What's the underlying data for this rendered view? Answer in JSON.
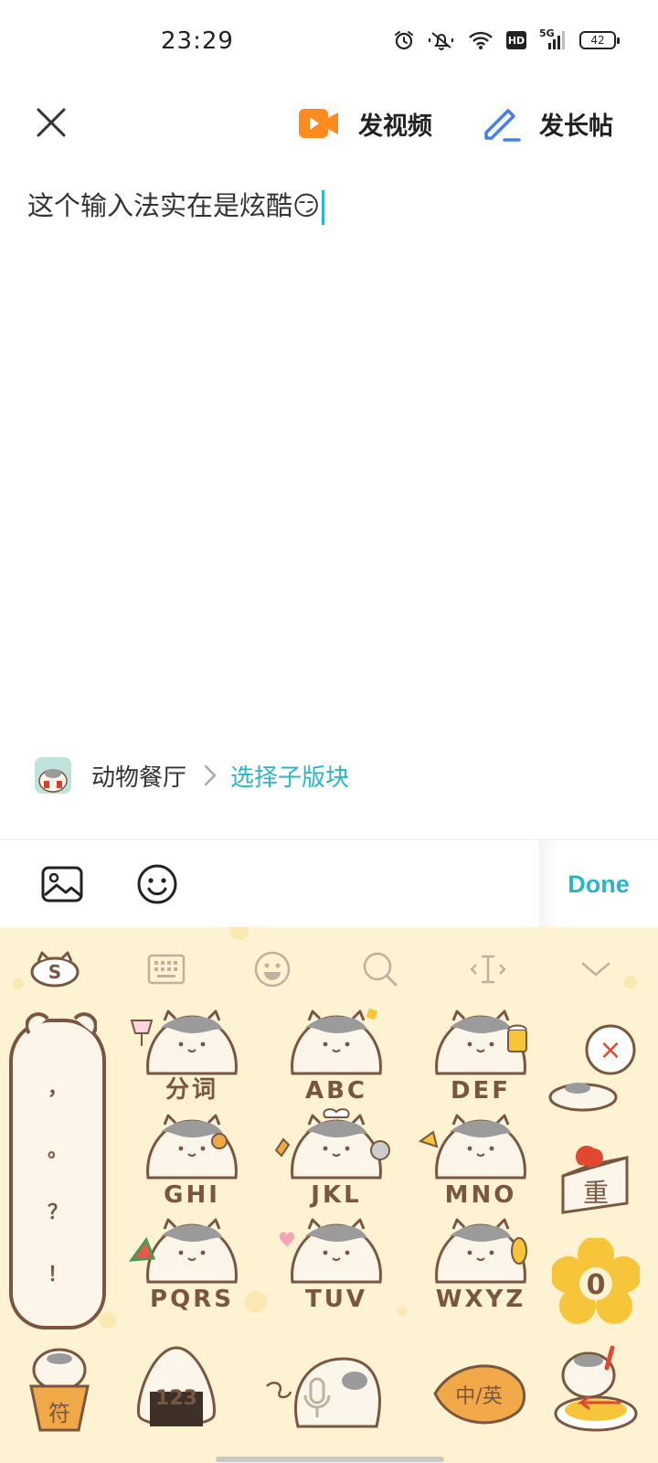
{
  "status_bar": {
    "time": "23:29",
    "icons": [
      "alarm-icon",
      "mute-icon",
      "wifi-icon",
      "hd-icon",
      "signal-5g-icon",
      "battery-icon"
    ],
    "hd_label": "HD",
    "network_label": "5G",
    "battery_level": "42"
  },
  "topbar": {
    "video_label": "发视频",
    "long_post_label": "发长帖",
    "colors": {
      "video_icon": "#ff8a1f",
      "pen_icon": "#4a7fe0"
    }
  },
  "compose": {
    "text": "这个输入法实在是炫酷",
    "emoji": "😏"
  },
  "forum": {
    "name": "动物餐厅",
    "subforum_label": "选择子版块",
    "accent": "#29b6c6"
  },
  "toolbar": {
    "done_label": "Done"
  },
  "keyboard": {
    "background": "#fdf2d2",
    "label_color": "#7a5640",
    "toolbar_icons": [
      "sogou-logo-icon",
      "keyboard-icon",
      "emoji-icon",
      "search-icon",
      "cursor-move-icon",
      "collapse-icon"
    ],
    "punctuation": [
      "，",
      "。",
      "？",
      "！"
    ],
    "keys": [
      {
        "label": "分词",
        "name": "key-split"
      },
      {
        "label": "ABC",
        "name": "key-abc"
      },
      {
        "label": "DEF",
        "name": "key-def"
      },
      {
        "label": "GHI",
        "name": "key-ghi"
      },
      {
        "label": "JKL",
        "name": "key-jkl"
      },
      {
        "label": "MNO",
        "name": "key-mno"
      },
      {
        "label": "PQRS",
        "name": "key-pqrs"
      },
      {
        "label": "TUV",
        "name": "key-tuv"
      },
      {
        "label": "WXYZ",
        "name": "key-wxyz"
      }
    ],
    "side_keys": {
      "delete": "×",
      "reenter": "重",
      "zero": "0"
    },
    "bottom_keys": {
      "symbols": "符",
      "numbers": "123",
      "lang": "中/英"
    }
  }
}
